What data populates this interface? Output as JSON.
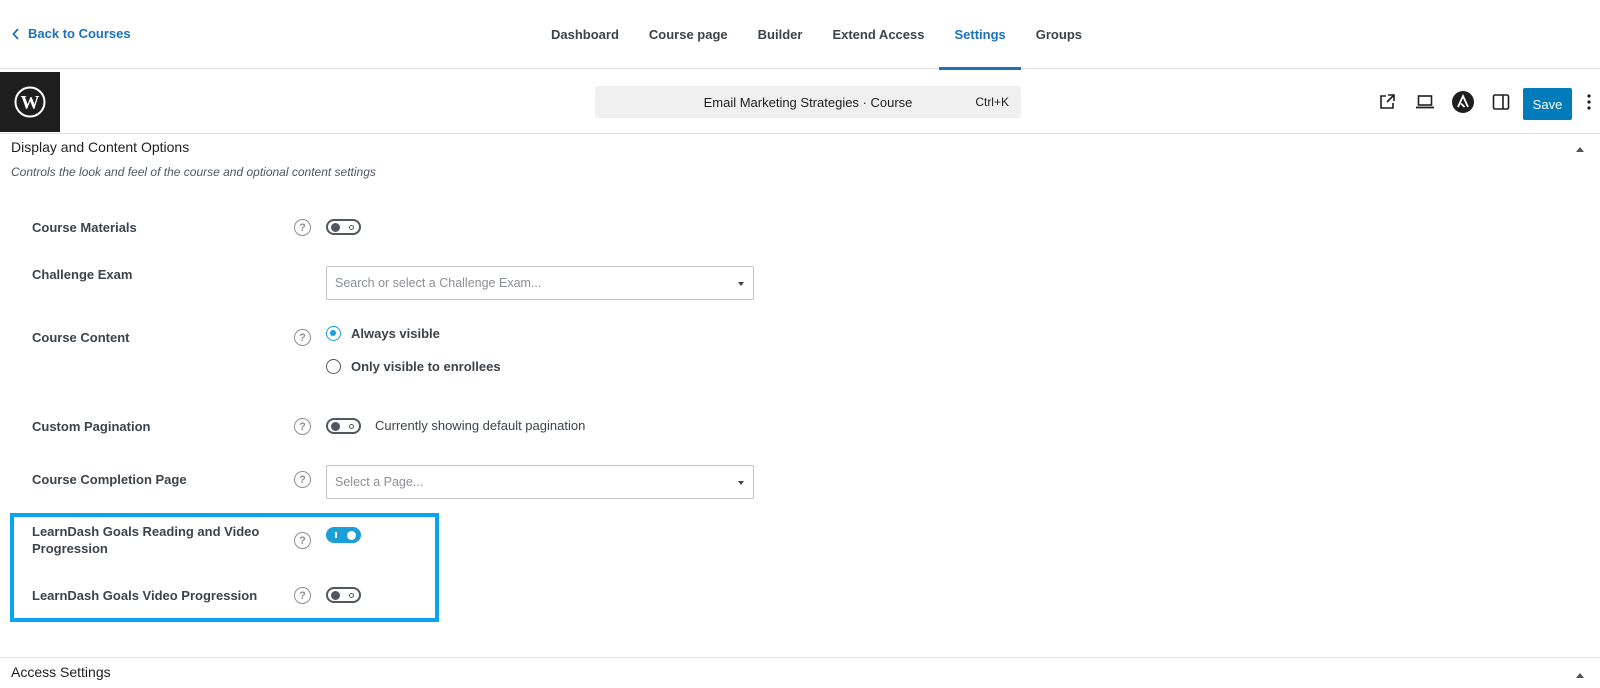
{
  "nav": {
    "back_label": "Back to Courses",
    "tabs": [
      "Dashboard",
      "Course page",
      "Builder",
      "Extend Access",
      "Settings",
      "Groups"
    ],
    "active_tab": "Settings"
  },
  "editor": {
    "command_title": "Email Marketing Strategies · Course",
    "shortcut": "Ctrl+K",
    "save_label": "Save",
    "accent_color": "#007cba",
    "icons": [
      "wordpress-logo-icon",
      "external-link-icon",
      "laptop-preview-icon",
      "astra-logo-icon",
      "sidebar-toggle-icon",
      "more-options-icon"
    ]
  },
  "display_section": {
    "title": "Display and Content Options",
    "description": "Controls the look and feel of the course and optional content settings",
    "course_materials": {
      "label": "Course Materials",
      "enabled": false
    },
    "challenge_exam": {
      "label": "Challenge Exam",
      "placeholder": "Search or select a Challenge Exam..."
    },
    "course_content": {
      "label": "Course Content",
      "options": [
        "Always visible",
        "Only visible to enrollees"
      ],
      "selected": "Always visible"
    },
    "custom_pagination": {
      "label": "Custom Pagination",
      "enabled": false,
      "status_text": "Currently showing default pagination"
    },
    "completion_page": {
      "label": "Course Completion Page",
      "placeholder": "Select a Page..."
    },
    "goals_reading_video": {
      "label_line1": "LearnDash Goals Reading and Video",
      "label_line2": "Progression",
      "enabled": true
    },
    "goals_video": {
      "label": "LearnDash Goals Video Progression",
      "enabled": false
    },
    "highlight_color": "#0aa5f0"
  },
  "access_section": {
    "title": "Access Settings"
  }
}
